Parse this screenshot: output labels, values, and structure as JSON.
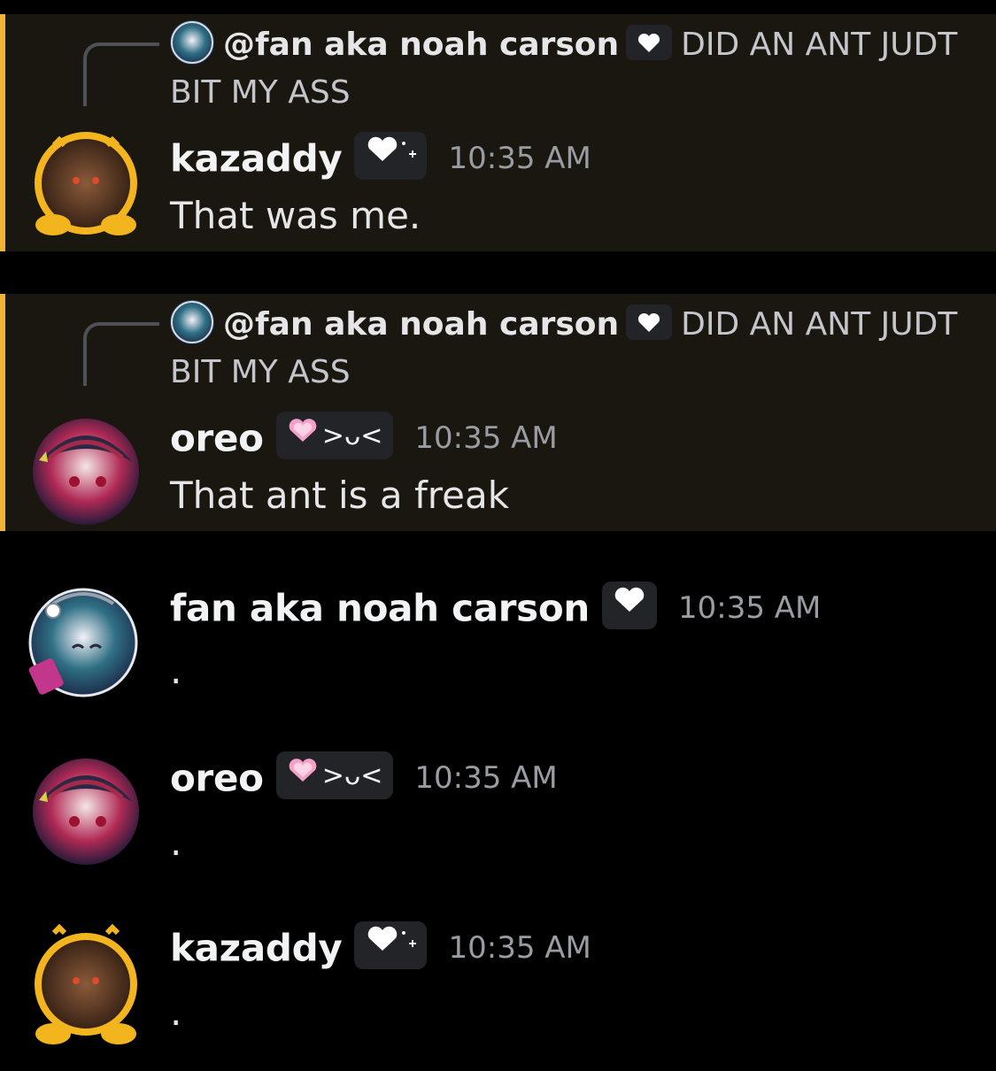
{
  "colors": {
    "background": "#000000",
    "highlight_bg": "#1a1710",
    "highlight_bar": "#f0b232",
    "timestamp": "#9a9ca3",
    "tag_bg": "#232428"
  },
  "messages": [
    {
      "reply": {
        "author": "@fan aka noah carson",
        "badge_icon": "white-heart-icon",
        "text_line1": "DID AN ANT JUDT",
        "text_line2": "BIT MY ASS"
      },
      "author": "kazaddy",
      "tag_icon": "white-heart-sparkle-icon",
      "tag_text": "",
      "time": "10:35 AM",
      "content": "That was me.",
      "highlighted": true
    },
    {
      "reply": {
        "author": "@fan aka noah carson",
        "badge_icon": "white-heart-icon",
        "text_line1": "DID AN ANT JUDT",
        "text_line2": "BIT MY ASS"
      },
      "author": "oreo",
      "tag_icon": "pink-heart-icon",
      "tag_text": ">ᴗ<",
      "time": "10:35 AM",
      "content": "That ant is a freak",
      "highlighted": true
    },
    {
      "author": "fan aka noah carson",
      "tag_icon": "white-heart-icon",
      "tag_text": "",
      "time": "10:35 AM",
      "content": "."
    },
    {
      "author": "oreo",
      "tag_icon": "pink-heart-icon",
      "tag_text": ">ᴗ<",
      "time": "10:35 AM",
      "content": "."
    },
    {
      "author": "kazaddy",
      "tag_icon": "white-heart-sparkle-icon",
      "tag_text": "",
      "time": "10:35 AM",
      "content": "."
    }
  ]
}
